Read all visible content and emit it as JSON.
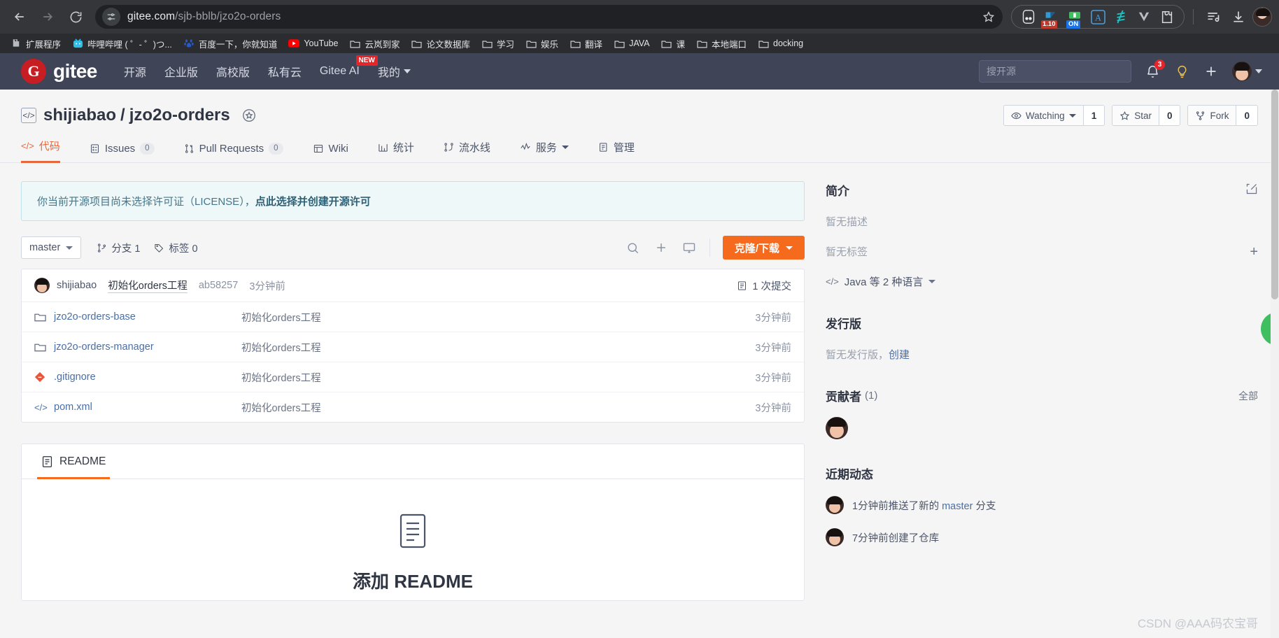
{
  "browser": {
    "url_host": "gitee.com",
    "url_path": "/sjb-bblb/jzo2o-orders",
    "back_icon": "back-arrow-icon",
    "forward_icon": "forward-arrow-icon",
    "reload_icon": "reload-icon",
    "site_info_icon": "site-settings-icon",
    "star_icon": "bookmark-star-icon",
    "extensions": [
      {
        "name": "tampermonkey-extension-icon",
        "badge": ""
      },
      {
        "name": "ublock-extension-icon",
        "badge": "1.10"
      },
      {
        "name": "adblock-extension-icon",
        "badge": "ON"
      },
      {
        "name": "immersive-translate-extension-icon",
        "badge": ""
      },
      {
        "name": "scrcpy-extension-icon",
        "badge": ""
      },
      {
        "name": "vimium-extension-icon",
        "badge": ""
      },
      {
        "name": "puzzle-extensions-icon",
        "badge": ""
      }
    ],
    "reading_list_icon": "reading-list-icon",
    "download_icon": "download-icon",
    "profile_icon": "chrome-profile-avatar"
  },
  "bookmarks": [
    {
      "label": "扩展程序",
      "icon": "puzzle-icon"
    },
    {
      "label": "哔哩哔哩 ( ゜- ゜)つ...",
      "icon": "bilibili-icon"
    },
    {
      "label": "百度一下，你就知道",
      "icon": "baidu-icon"
    },
    {
      "label": "YouTube",
      "icon": "youtube-icon"
    },
    {
      "label": "云岚到家",
      "icon": "folder-icon"
    },
    {
      "label": "论文数据库",
      "icon": "folder-icon"
    },
    {
      "label": "学习",
      "icon": "folder-icon"
    },
    {
      "label": "娱乐",
      "icon": "folder-icon"
    },
    {
      "label": "翻译",
      "icon": "folder-icon"
    },
    {
      "label": "JAVA",
      "icon": "folder-icon"
    },
    {
      "label": "课",
      "icon": "folder-icon"
    },
    {
      "label": "本地端口",
      "icon": "folder-icon"
    },
    {
      "label": "docking",
      "icon": "folder-icon"
    }
  ],
  "gitee_header": {
    "logo_letter": "G",
    "logo_text": "gitee",
    "nav": [
      {
        "label": "开源"
      },
      {
        "label": "企业版"
      },
      {
        "label": "高校版"
      },
      {
        "label": "私有云"
      },
      {
        "label": "Gitee AI",
        "badge": "NEW"
      },
      {
        "label": "我的",
        "caret": true
      }
    ],
    "search_placeholder": "搜开源",
    "notification_count": "3",
    "bell_icon": "bell-icon",
    "lightbulb_icon": "lightbulb-icon",
    "plus_icon": "plus-icon",
    "avatar": "user-avatar"
  },
  "repo": {
    "owner": "shijiabao",
    "separator": "/",
    "name": "jzo2o-orders",
    "gift_icon": "gift-icon",
    "actions": [
      {
        "icon": "eye-icon",
        "label": "Watching",
        "count": "1",
        "caret": true
      },
      {
        "icon": "star-icon",
        "label": "Star",
        "count": "0"
      },
      {
        "icon": "fork-icon",
        "label": "Fork",
        "count": "0"
      }
    ],
    "tabs": [
      {
        "label": "代码",
        "icon": "code-icon",
        "active": true
      },
      {
        "label": "Issues",
        "icon": "issues-icon",
        "count": "0"
      },
      {
        "label": "Pull Requests",
        "icon": "pull-request-icon",
        "count": "0"
      },
      {
        "label": "Wiki",
        "icon": "wiki-icon"
      },
      {
        "label": "统计",
        "icon": "stats-icon"
      },
      {
        "label": "流水线",
        "icon": "pipeline-icon"
      },
      {
        "label": "服务",
        "icon": "service-icon",
        "caret": true
      },
      {
        "label": "管理",
        "icon": "manage-icon"
      }
    ]
  },
  "license_notice": {
    "text": "你当前开源项目尚未选择许可证（LICENSE），",
    "link": "点此选择并创建开源许可"
  },
  "toolbar": {
    "branch": "master",
    "branches_label": "分支 1",
    "tags_label": "标签 0",
    "search_icon": "search-icon",
    "add_icon": "plus-icon",
    "ide_icon": "web-ide-icon",
    "clone_label": "克隆/下载"
  },
  "commit": {
    "author": "shijiabao",
    "message": "初始化orders工程",
    "sha": "ab58257",
    "time": "3分钟前",
    "count_label": "1 次提交",
    "count_icon": "history-icon"
  },
  "files": [
    {
      "name": "jzo2o-orders-base",
      "icon": "folder-icon",
      "message": "初始化orders工程",
      "time": "3分钟前"
    },
    {
      "name": "jzo2o-orders-manager",
      "icon": "folder-icon",
      "message": "初始化orders工程",
      "time": "3分钟前"
    },
    {
      "name": ".gitignore",
      "icon": "git-file-icon",
      "message": "初始化orders工程",
      "time": "3分钟前"
    },
    {
      "name": "pom.xml",
      "icon": "xml-file-icon",
      "message": "初始化orders工程",
      "time": "3分钟前"
    }
  ],
  "readme": {
    "tab_label": "README",
    "tab_icon": "readme-icon",
    "empty_icon": "document-icon",
    "cta": "添加 README"
  },
  "sidebar": {
    "intro_title": "简介",
    "edit_icon": "edit-icon",
    "no_description": "暂无描述",
    "no_tags": "暂无标签",
    "add_tag_icon": "plus-icon",
    "language": "Java 等 2 种语言",
    "language_icon": "code-icon",
    "release_title": "发行版",
    "release_empty": "暂无发行版，",
    "release_create": "创建",
    "contributors_title": "贡献者",
    "contributors_count": "(1)",
    "contributors_all": "全部",
    "activity_title": "近期动态",
    "activities": [
      {
        "prefix": "1分钟前推送了新的 ",
        "link": "master",
        "suffix": " 分支"
      },
      {
        "prefix": "7分钟前创建了仓库",
        "link": "",
        "suffix": ""
      }
    ]
  },
  "watermark": "CSDN @AAA码农宝哥",
  "colors": {
    "accent": "#f66a1e",
    "brand_red": "#c71d23",
    "header_bg": "#3f4457",
    "link": "#4a6fa5"
  }
}
